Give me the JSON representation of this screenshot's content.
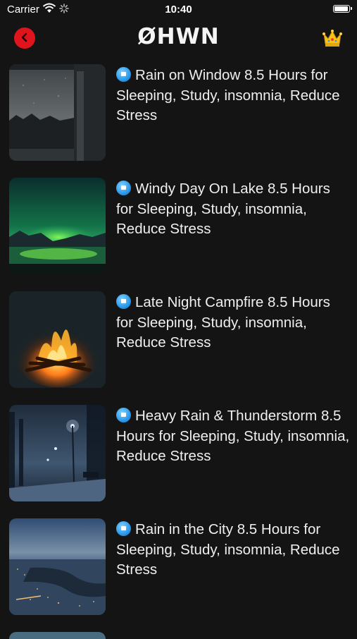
{
  "status_bar": {
    "carrier": "Carrier",
    "time": "10:40"
  },
  "nav": {
    "title": "ØHWN",
    "back_icon": "chevron-left-icon",
    "premium_icon": "crown-icon"
  },
  "colors": {
    "background": "#141414",
    "back_button": "#e0141d",
    "badge": "#2a9cf0"
  },
  "items": [
    {
      "title": "Rain on Window 8.5 Hours for Sleeping, Study, insomnia, Reduce Stress"
    },
    {
      "title": "Windy Day On Lake 8.5 Hours for Sleeping, Study, insomnia, Reduce Stress"
    },
    {
      "title": "Late Night Campfire 8.5 Hours for Sleeping, Study, insomnia, Reduce Stress"
    },
    {
      "title": "Heavy Rain & Thunderstorm 8.5 Hours for Sleeping, Study, insomnia, Reduce Stress"
    },
    {
      "title": "Rain in the City 8.5 Hours for Sleeping, Study, insomnia, Reduce Stress"
    }
  ]
}
